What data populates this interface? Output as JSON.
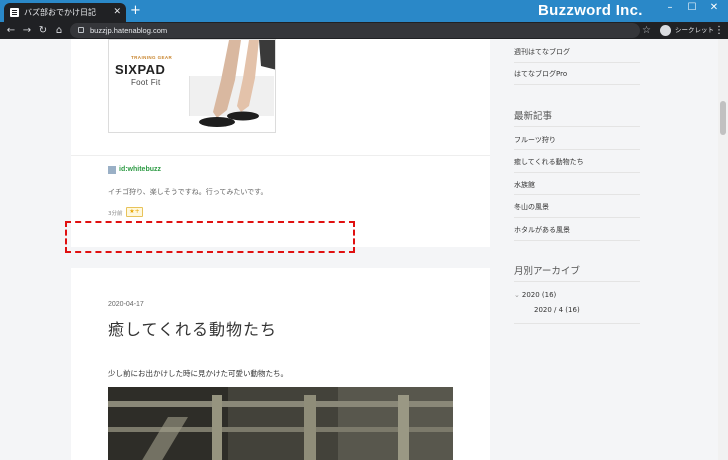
{
  "browser": {
    "tab_title": "バズ部おでかけ日記",
    "url": "buzzjp.hatenablog.com",
    "brand": "Buzzword Inc.",
    "incognito_label": "シークレット",
    "window_controls": [
      "–",
      "☐",
      "✕"
    ]
  },
  "ad": {
    "tagline": "TRAINING GEAR",
    "brand": "SIXPAD",
    "product": "Foot Fit"
  },
  "comment": {
    "user": "id:whitebuzz",
    "text": "イチゴ狩り、楽しそうですね。行ってみたいです。",
    "time": "3分前",
    "star_label": "★+"
  },
  "post": {
    "date": "2020-04-17",
    "title": "癒してくれる動物たち",
    "body": "少し前にお出かけした時に見かけた可愛い動物たち。"
  },
  "sidebar": {
    "links_top": [
      "週刊はてなブログ",
      "はてなブログPro"
    ],
    "recent_heading": "最新記事",
    "recent": [
      "フルーツ狩り",
      "癒してくれる動物たち",
      "水族館",
      "冬山の風景",
      "ホタルがある風景"
    ],
    "archive_heading": "月別アーカイブ",
    "archive_year": "2020 (16)",
    "archive_month": "2020 / 4 (16)"
  }
}
